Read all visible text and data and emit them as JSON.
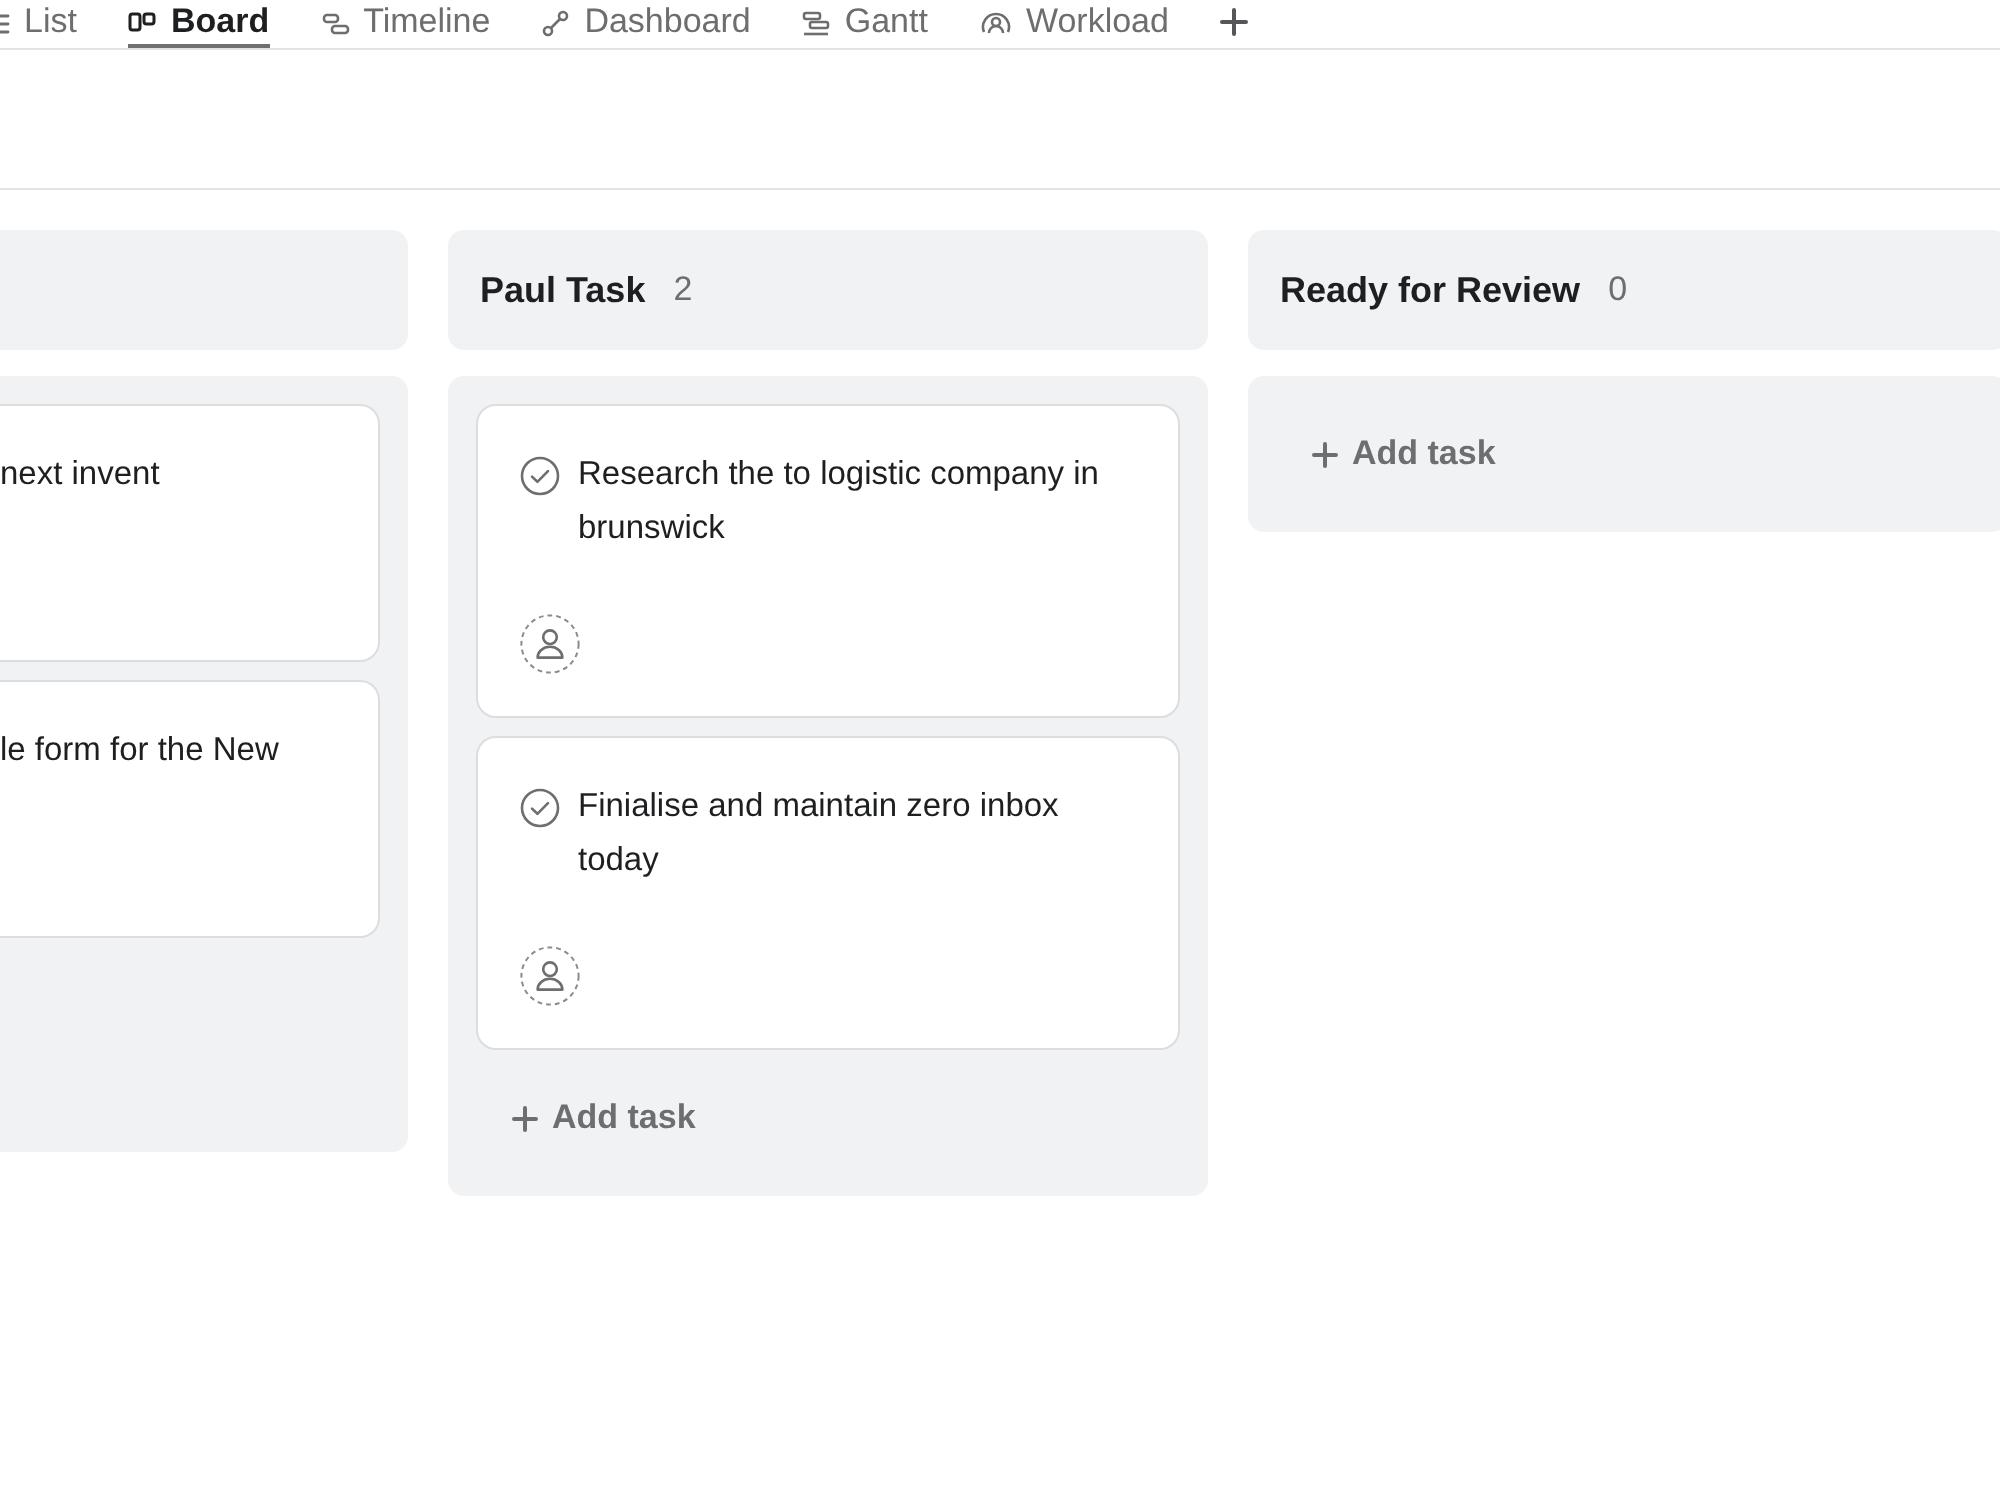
{
  "tabs": [
    {
      "label": "List",
      "kind": "list",
      "selected": false
    },
    {
      "label": "Board",
      "kind": "board",
      "selected": true
    },
    {
      "label": "Timeline",
      "kind": "timeline",
      "selected": false
    },
    {
      "label": "Dashboard",
      "kind": "dashboard",
      "selected": false
    },
    {
      "label": "Gantt",
      "kind": "gantt",
      "selected": false
    },
    {
      "label": "Workload",
      "kind": "workload",
      "selected": false
    }
  ],
  "board": {
    "columns": [
      {
        "tasks": [
          {
            "title": "next invent"
          },
          {
            "title": "le form for the New"
          }
        ]
      },
      {
        "title": "Paul Task",
        "count": "2",
        "tasks": [
          {
            "title": "Research the to logistic company in brunswick"
          },
          {
            "title": "Finialise and maintain zero inbox today"
          }
        ],
        "add_task": "Add task"
      },
      {
        "title": "Ready for Review",
        "count": "0",
        "add_task": "Add task"
      }
    ]
  }
}
